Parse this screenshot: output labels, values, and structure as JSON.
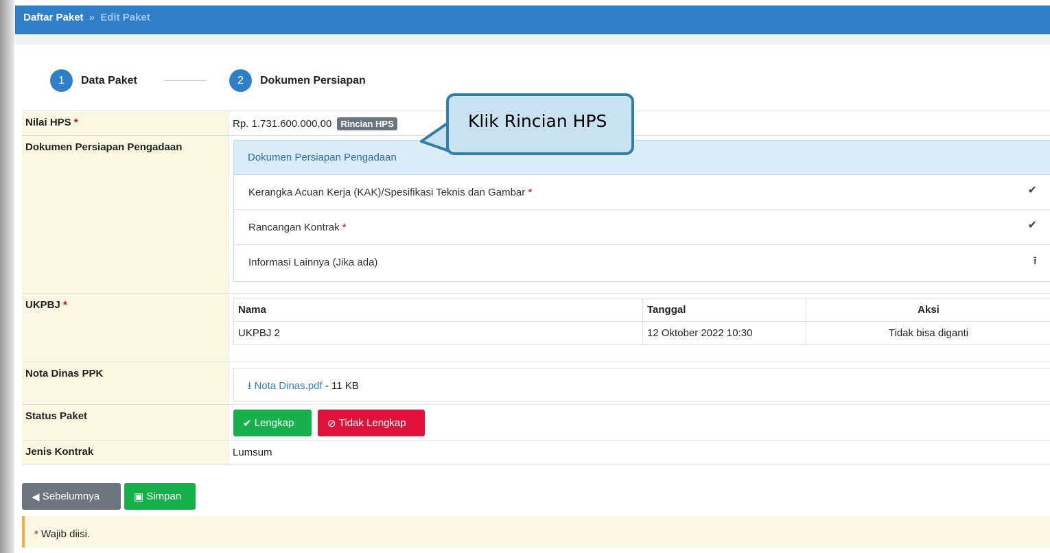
{
  "breadcrumb": {
    "parent": "Daftar Paket",
    "separator": "»",
    "current": "Edit Paket"
  },
  "steps": [
    {
      "number": "1",
      "label": "Data Paket"
    },
    {
      "number": "2",
      "label": "Dokumen Persiapan"
    }
  ],
  "form": {
    "nilai_hps": {
      "label": "Nilai HPS",
      "required_mark": "*",
      "value": "Rp. 1.731.600.000,00",
      "button": "Rincian HPS"
    },
    "dokumen": {
      "label": "Dokumen Persiapan Pengadaan",
      "panel_title": "Dokumen Persiapan Pengadaan",
      "items": [
        {
          "label": "Kerangka Acuan Kerja (KAK)/Spesifikasi Teknis dan Gambar",
          "required_mark": "*",
          "icon": "check-icon",
          "glyph": "✔"
        },
        {
          "label": "Rancangan Kontrak",
          "required_mark": "*",
          "icon": "check-icon",
          "glyph": "✔"
        },
        {
          "label": "Informasi Lainnya (Jika ada)",
          "required_mark": "",
          "icon": "upload-icon",
          "glyph": "⭱"
        }
      ]
    },
    "ukpbj": {
      "label": "UKPBJ",
      "required_mark": "*",
      "headers": {
        "nama": "Nama",
        "tanggal": "Tanggal",
        "aksi": "Aksi"
      },
      "rows": [
        {
          "nama": "UKPBJ 2",
          "tanggal": "12 Oktober 2022 10:30",
          "aksi": "Tidak bisa diganti"
        }
      ]
    },
    "nota_dinas": {
      "label": "Nota Dinas PPK",
      "file": "Nota Dinas.pdf",
      "size": " - 11 KB"
    },
    "status_paket": {
      "label": "Status Paket",
      "lengkap": "Lengkap",
      "tidak_lengkap": "Tidak Lengkap"
    },
    "jenis_kontrak": {
      "label": "Jenis Kontrak",
      "value": "Lumsum"
    }
  },
  "actions": {
    "back": "Sebelumnya",
    "save": "Simpan"
  },
  "note": {
    "mark": "*",
    "text": "Wajib diisi."
  },
  "callout": {
    "text": "Klik Rincian HPS"
  },
  "colors": {
    "primary": "#2f7fc8",
    "label_bg": "#fbf8e2",
    "success": "#17b14b",
    "danger": "#e0123c",
    "secondary": "#6c757d",
    "callout_bg": "#c8e2f1"
  }
}
